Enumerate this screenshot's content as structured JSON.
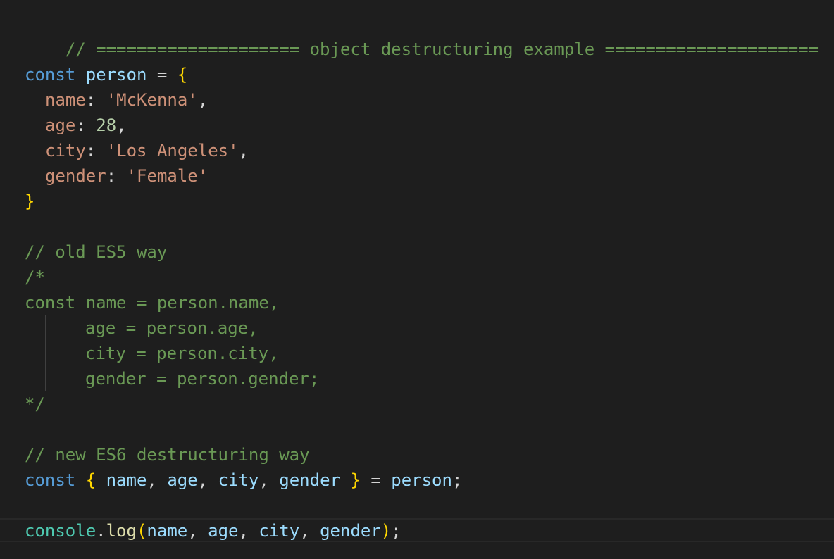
{
  "editor": {
    "theme_colors": {
      "background": "#1e1e1e",
      "comment": "#6a9955",
      "keyword": "#569cd6",
      "variable": "#9cdcfe",
      "string": "#ce9178",
      "number": "#b5cea8",
      "brace": "#ffd700",
      "function": "#dcdcaa",
      "object": "#4ec9b0"
    },
    "lines": {
      "l1_comment": "// ==================== object destructuring example =====================",
      "l3_const": "const",
      "l3_person": "person",
      "l3_eq": " = ",
      "l3_brace": "{",
      "l4_key": "name",
      "l4_colon": ": ",
      "l4_value": "'McKenna'",
      "l4_comma": ",",
      "l5_key": "age",
      "l5_colon": ": ",
      "l5_value": "28",
      "l5_comma": ",",
      "l6_key": "city",
      "l6_colon": ": ",
      "l6_value": "'Los Angeles'",
      "l6_comma": ",",
      "l7_key": "gender",
      "l7_colon": ": ",
      "l7_value": "'Female'",
      "l8_brace": "}",
      "l10_comment": "// old ES5 way",
      "l11_comment": "/*",
      "l12_comment": "const name = person.name,",
      "l13_comment": "age = person.age,",
      "l14_comment": "city = person.city,",
      "l15_comment": "gender = person.gender;",
      "l16_comment": "*/",
      "l18_comment": "// new ES6 destructuring way",
      "l19_const": "const",
      "l19_open": "{",
      "l19_name": "name",
      "l19_age": "age",
      "l19_city": "city",
      "l19_gender": "gender",
      "l19_close": "}",
      "l19_eq": " = ",
      "l19_person": "person",
      "l19_semi": ";",
      "l21_console": "console",
      "l21_dot": ".",
      "l21_log": "log",
      "l21_open": "(",
      "l21_name": "name",
      "l21_age": "age",
      "l21_city": "city",
      "l21_gender": "gender",
      "l21_close": ")",
      "l21_semi": ";",
      "sep": ", ",
      "space": " "
    }
  }
}
